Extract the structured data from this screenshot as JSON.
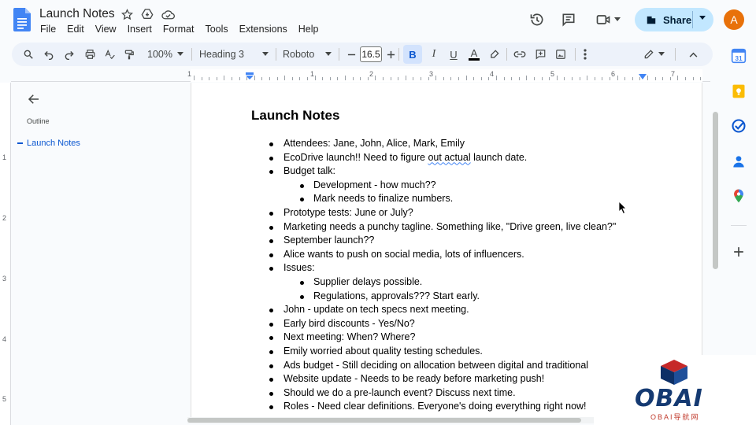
{
  "app": {
    "doc_title": "Launch Notes",
    "menu": [
      "File",
      "Edit",
      "View",
      "Insert",
      "Format",
      "Tools",
      "Extensions",
      "Help"
    ],
    "share_label": "Share",
    "avatar_letter": "A",
    "accent_color": "#0b57d0",
    "share_bg": "#c2e7ff"
  },
  "toolbar": {
    "zoom": "100%",
    "style": "Heading 3",
    "font": "Roboto",
    "font_size": "16.5",
    "bold_label": "B",
    "italic_label": "I",
    "underline_label": "U",
    "text_color_label": "A"
  },
  "ruler": {
    "numbers": [
      "1",
      "1",
      "2",
      "3",
      "4",
      "5",
      "6",
      "7"
    ],
    "v_numbers": [
      "1",
      "2",
      "3",
      "4",
      "5"
    ]
  },
  "outline": {
    "label": "Outline",
    "items": [
      "Launch Notes"
    ]
  },
  "document": {
    "heading": "Launch Notes",
    "items": [
      {
        "level": 1,
        "text": "Attendees: Jane, John, Alice, Mark, Emily"
      },
      {
        "level": 1,
        "text_before": "EcoDrive launch!! Need to figure ",
        "text_spell": "out actual",
        "text_after": " launch date."
      },
      {
        "level": 1,
        "text": "Budget talk:"
      },
      {
        "level": 2,
        "text": "Development - how much??"
      },
      {
        "level": 2,
        "text": "Mark needs to finalize numbers."
      },
      {
        "level": 1,
        "text": "Prototype tests: June or July?"
      },
      {
        "level": 1,
        "text": "Marketing needs a punchy tagline. Something like, \"Drive green, live clean?\""
      },
      {
        "level": 1,
        "text": "September launch??"
      },
      {
        "level": 1,
        "text": "Alice wants to push on social media, lots of influencers."
      },
      {
        "level": 1,
        "text": "Issues:"
      },
      {
        "level": 2,
        "text": "Supplier delays possible."
      },
      {
        "level": 2,
        "text": "Regulations, approvals??? Start early."
      },
      {
        "level": 1,
        "text": "John - update on tech specs next meeting."
      },
      {
        "level": 1,
        "text": "Early bird discounts - Yes/No?"
      },
      {
        "level": 1,
        "text": "Next meeting: When? Where?"
      },
      {
        "level": 1,
        "text": "Emily worried about quality testing schedules."
      },
      {
        "level": 1,
        "text": "Ads budget - Still deciding on allocation between digital and traditional"
      },
      {
        "level": 1,
        "text": "Website update - Needs to be ready before marketing push!"
      },
      {
        "level": 1,
        "text": "Should we do a pre-launch event? Discuss next time."
      },
      {
        "level": 1,
        "text": "Roles - Need clear definitions. Everyone's doing everything right now!"
      }
    ]
  },
  "watermark": {
    "text": "OBAI",
    "sub": "OBAI导航网"
  },
  "icons": {
    "title": [
      "star-icon",
      "move-to-drive-icon",
      "cloud-saved-icon"
    ],
    "top_right": [
      "version-history-icon",
      "comments-icon",
      "meet-icon"
    ],
    "side_panel": [
      "calendar-icon",
      "keep-icon",
      "tasks-icon",
      "contacts-icon",
      "maps-icon",
      "add-icon"
    ]
  }
}
